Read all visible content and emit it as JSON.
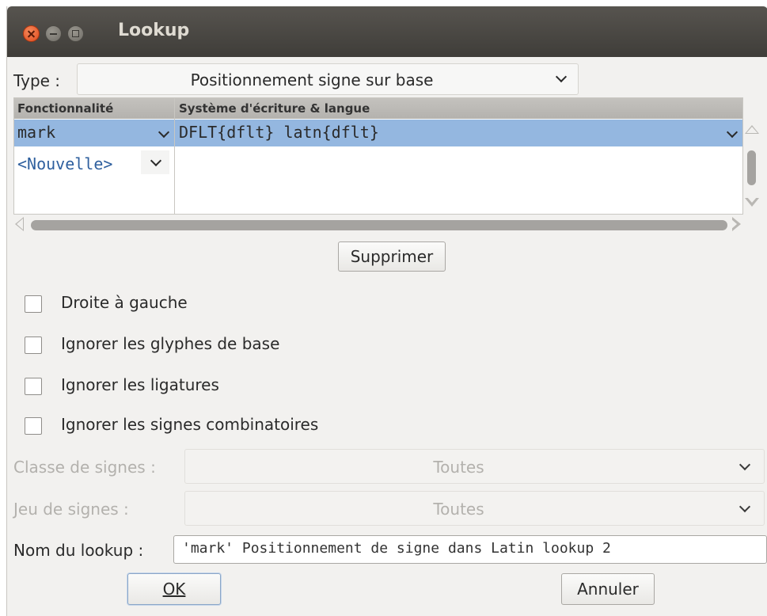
{
  "window": {
    "title": "Lookup"
  },
  "type_field": {
    "label": "Type :",
    "value": "Positionnement signe sur base"
  },
  "table": {
    "headers": [
      "Fonctionnalité",
      "Système d'écriture & langue"
    ],
    "rows": [
      {
        "feature": "mark",
        "script": "DFLT{dflt} latn{dflt}",
        "selected": true
      },
      {
        "feature": "<Nouvelle>",
        "script": "",
        "selected": false
      }
    ]
  },
  "delete_button": "Supprimer",
  "checkboxes": [
    {
      "label": "Droite à gauche",
      "checked": false
    },
    {
      "label": "Ignorer les glyphes de base",
      "checked": false
    },
    {
      "label": "Ignorer les ligatures",
      "checked": false
    },
    {
      "label": "Ignorer les signes combinatoires",
      "checked": false
    }
  ],
  "mark_class": {
    "label": "Classe de signes :",
    "value": "Toutes",
    "enabled": false
  },
  "mark_set": {
    "label": "Jeu de signes :",
    "value": "Toutes",
    "enabled": false
  },
  "lookup_name": {
    "label": "Nom du lookup :",
    "value": "'mark' Positionnement de signe dans Latin lookup 2"
  },
  "buttons": {
    "ok": "OK",
    "cancel": "Annuler"
  },
  "colors": {
    "selection": "#94b7e0",
    "titlebar": "#3f3d39",
    "new_item": "#2e5f9e"
  }
}
